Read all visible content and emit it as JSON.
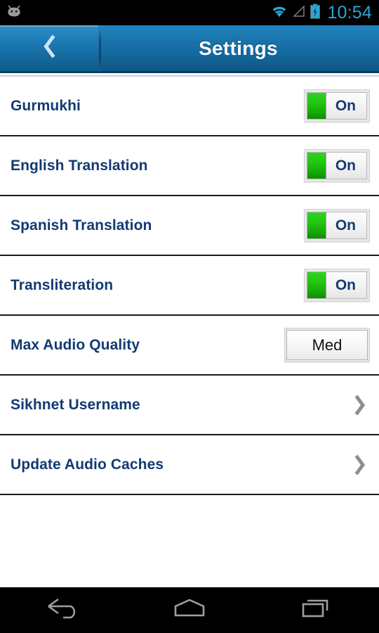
{
  "status_bar": {
    "notification_icon": "android-head-icon",
    "wifi_icon": "wifi-icon",
    "signal_icon": "cell-signal-icon",
    "battery_icon": "battery-charging-icon",
    "time": "10:54",
    "time_color": "#2aa4d6"
  },
  "action_bar": {
    "back_icon": "chevron-left-icon",
    "title": "Settings",
    "background_color": "#156ca2",
    "title_color": "#ffffff"
  },
  "settings": {
    "accent_label_color": "#123a73",
    "toggle_on_color": "#22c50f",
    "rows": [
      {
        "label": "Gurmukhi",
        "control": "toggle",
        "value": "On"
      },
      {
        "label": "English Translation",
        "control": "toggle",
        "value": "On"
      },
      {
        "label": "Spanish Translation",
        "control": "toggle",
        "value": "On"
      },
      {
        "label": "Transliteration",
        "control": "toggle",
        "value": "On"
      },
      {
        "label": "Max Audio Quality",
        "control": "button",
        "value": "Med"
      },
      {
        "label": "Sikhnet Username",
        "control": "chevron",
        "value": ""
      },
      {
        "label": "Update Audio Caches",
        "control": "chevron",
        "value": ""
      }
    ]
  },
  "nav_bar": {
    "back_label": "back-nav-icon",
    "home_label": "home-nav-icon",
    "recents_label": "recents-nav-icon"
  }
}
